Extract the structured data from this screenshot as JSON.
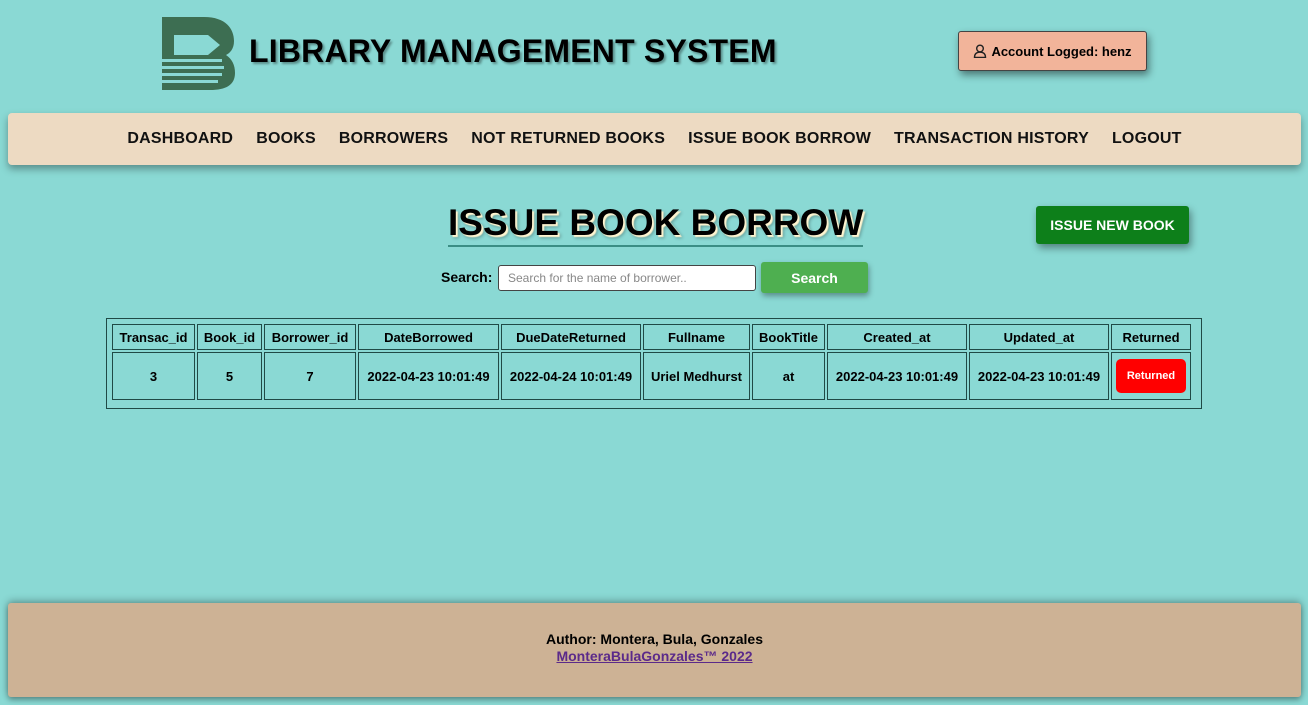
{
  "header": {
    "title": "LIBRARY MANAGEMENT SYSTEM",
    "logo_icon": "book-logo-icon",
    "account_label": "Account Logged: henz",
    "account_icon": "user-icon"
  },
  "nav": {
    "items": [
      "DASHBOARD",
      "BOOKS",
      "BORROWERS",
      "NOT RETURNED BOOKS",
      "ISSUE BOOK BORROW",
      "TRANSACTION HISTORY",
      "LOGOUT"
    ]
  },
  "page": {
    "title": "ISSUE BOOK BORROW",
    "issue_new_label": "ISSUE NEW BOOK"
  },
  "search": {
    "label": "Search:",
    "placeholder": "Search for the name of borrower..",
    "value": "",
    "button_label": "Search"
  },
  "table": {
    "columns": [
      "Transac_id",
      "Book_id",
      "Borrower_id",
      "DateBorrowed",
      "DueDateReturned",
      "Fullname",
      "BookTitle",
      "Created_at",
      "Updated_at",
      "Returned"
    ],
    "rows": [
      [
        "3",
        "5",
        "7",
        "2022-04-23 10:01:49",
        "2022-04-24 10:01:49",
        "Uriel Medhurst",
        "at",
        "2022-04-23 10:01:49",
        "2022-04-23 10:01:49"
      ]
    ],
    "action_label": "Returned"
  },
  "footer": {
    "author": "Author: Montera, Bula, Gonzales",
    "link": "MonteraBulaGonzales™ 2022"
  },
  "colors": {
    "background": "#8ad9d4",
    "nav_bg": "#eddac2",
    "footer_bg": "#cdb295",
    "issue_button": "#0d7f1a",
    "search_button": "#4eaf50",
    "returned_button": "#ff0000",
    "account_badge": "#f2b49a"
  }
}
